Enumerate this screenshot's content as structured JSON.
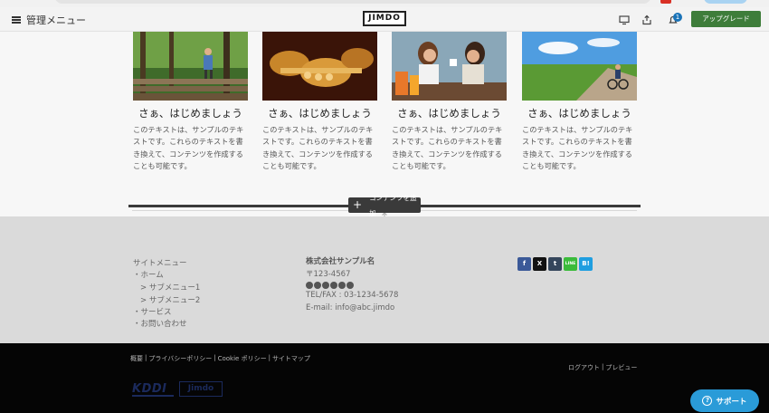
{
  "admin_bar": {
    "menu_label": "管理メニュー",
    "logo": "JIMDO",
    "notification_count": "1",
    "upgrade_label": "アップグレード",
    "icons": [
      "hamburger-icon",
      "desktop-preview-icon",
      "share-icon",
      "bell-icon"
    ]
  },
  "cards": [
    {
      "title": "さぁ、はじめましょう",
      "body": "このテキストは、サンプルのテキストです。これらのテキストを書き換えて、コンテンツを作成することも可能です。",
      "image": "forest-stairs-photo"
    },
    {
      "title": "さぁ、はじめましょう",
      "body": "このテキストは、サンプルのテキストです。これらのテキストを書き換えて、コンテンツを作成することも可能です。",
      "image": "brass-instruments-photo"
    },
    {
      "title": "さぁ、はじめましょう",
      "body": "このテキストは、サンプルのテキストです。これらのテキストを書き換えて、コンテンツを作成することも可能です。",
      "image": "cafe-friends-photo"
    },
    {
      "title": "さぁ、はじめましょう",
      "body": "このテキストは、サンプルのテキストです。これらのテキストを書き換えて、コンテンツを作成することも可能です。",
      "image": "cycling-road-photo"
    }
  ],
  "add_content_label": "コンテンツを追加",
  "footer": {
    "site_menu_label": "サイトメニュー",
    "nav": [
      "・ホーム",
      "> サブメニュー1",
      "> サブメニュー2",
      "・サービス",
      "・お問い合わせ"
    ],
    "company_name": "株式会社サンプル名",
    "postal": "〒123-4567",
    "tel": "TEL/FAX : 03-1234-5678",
    "email": "E-mail: info@abc.jimdo",
    "social": [
      {
        "label": "f",
        "icon": "facebook-icon",
        "color": "#3b5998"
      },
      {
        "label": "X",
        "icon": "x-icon",
        "color": "#111111"
      },
      {
        "label": "t",
        "icon": "tumblr-icon",
        "color": "#35465c"
      },
      {
        "label": "LINE",
        "icon": "line-icon",
        "color": "#3bbb3b"
      },
      {
        "label": "B!",
        "icon": "hatena-icon",
        "color": "#1f9ee0"
      }
    ]
  },
  "bottom": {
    "links": [
      "概要",
      "|",
      "プライバシーポリシー",
      "|",
      "Cookie ポリシー",
      "|",
      "サイトマップ"
    ],
    "right_links": [
      "ログアウト",
      "|",
      "プレビュー"
    ],
    "kddi": "KDDI",
    "jimdo": "Jimdo"
  },
  "support_label": "サポート"
}
